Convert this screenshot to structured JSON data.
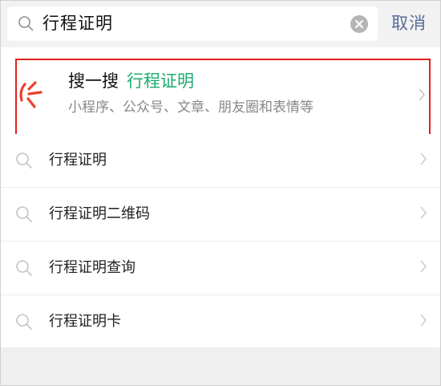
{
  "search": {
    "query": "行程证明",
    "cancel_label": "取消"
  },
  "sousou": {
    "title": "搜一搜",
    "keyword": "行程证明",
    "subtitle": "小程序、公众号、文章、朋友圈和表情等"
  },
  "suggestions": [
    {
      "label": "行程证明"
    },
    {
      "label": "行程证明二维码"
    },
    {
      "label": "行程证明查询"
    },
    {
      "label": "行程证明卡"
    }
  ],
  "colors": {
    "accent_green": "#1aad6e",
    "link_blue": "#576b95",
    "highlight_red": "#e02020"
  }
}
